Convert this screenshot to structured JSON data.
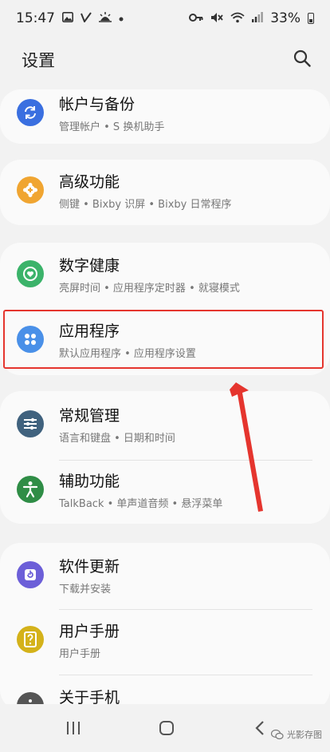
{
  "status_bar": {
    "time": "15:47",
    "battery": "33%",
    "left_icons": [
      "image-icon",
      "check-icon",
      "weather-icon",
      "dot-icon"
    ],
    "right_icons": [
      "key-icon",
      "mute-icon",
      "wifi-icon",
      "signal-icon",
      "battery-icon"
    ]
  },
  "header": {
    "title": "设置"
  },
  "items": [
    {
      "title": "帐户与备份",
      "subtitle": "管理帐户 • S 换机助手",
      "icon": "sync-icon",
      "color": "#3a6fe0"
    },
    {
      "title": "高级功能",
      "subtitle": "侧键 • Bixby 识屏 • Bixby 日常程序",
      "icon": "gear-plus-icon",
      "color": "#f0a531"
    },
    {
      "title": "数字健康",
      "subtitle": "亮屏时间 • 应用程序定时器 • 就寝模式",
      "icon": "heart-circle-icon",
      "color": "#3bb36a"
    },
    {
      "title": "应用程序",
      "subtitle": "默认应用程序 • 应用程序设置",
      "icon": "apps-grid-icon",
      "color": "#4a90e8"
    },
    {
      "title": "常规管理",
      "subtitle": "语言和键盘 • 日期和时间",
      "icon": "sliders-icon",
      "color": "#40627e"
    },
    {
      "title": "辅助功能",
      "subtitle": "TalkBack • 单声道音频 • 悬浮菜单",
      "icon": "accessibility-icon",
      "color": "#2f8d46"
    },
    {
      "title": "软件更新",
      "subtitle": "下载并安装",
      "icon": "update-icon",
      "color": "#6c5fd8"
    },
    {
      "title": "用户手册",
      "subtitle": "用户手册",
      "icon": "manual-icon",
      "color": "#d4b21a"
    },
    {
      "title": "关于手机",
      "subtitle": "",
      "icon": "info-icon",
      "color": "#555555"
    }
  ],
  "watermark": "光影存图",
  "colors": {
    "highlight": "#e5352e",
    "background": "#f2f2f2",
    "card": "#fafafa"
  }
}
